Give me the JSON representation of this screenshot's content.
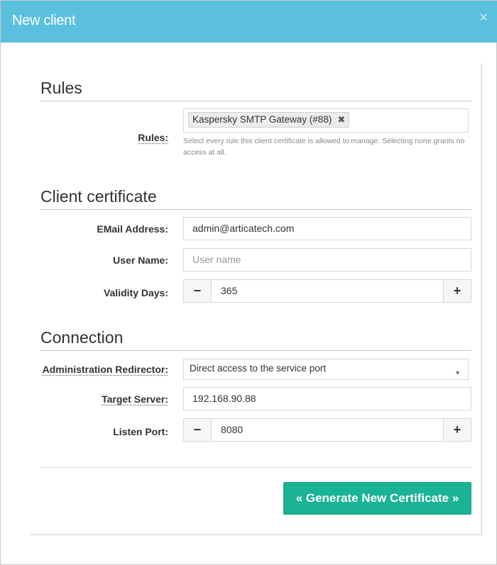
{
  "modal": {
    "title": "New client",
    "close_glyph": "×"
  },
  "sections": {
    "rules": {
      "title": "Rules"
    },
    "certificate": {
      "title": "Client certificate"
    },
    "connection": {
      "title": "Connection"
    }
  },
  "rules_field": {
    "label": "Rules:",
    "selected_tags": [
      "Kaspersky SMTP Gateway (#88)"
    ],
    "remove_glyph": "✖",
    "help": "Select every rule this client certificate is allowed to manage. Selecting none grants no access at all."
  },
  "email": {
    "label": "EMail Address:",
    "value": "admin@articatech.com"
  },
  "username": {
    "label": "User Name:",
    "value": "",
    "placeholder": "User name"
  },
  "validity": {
    "label": "Validity Days:",
    "value": "365",
    "minus": "−",
    "plus": "+"
  },
  "redirector": {
    "label": "Administration Redirector:",
    "selected": "Direct access to the service port",
    "caret": "▼"
  },
  "target": {
    "label": "Target Server:",
    "value": "192.168.90.88"
  },
  "listen_port": {
    "label": "Listen Port:",
    "value": "8080",
    "minus": "−",
    "plus": "+"
  },
  "actions": {
    "generate_label": "« Generate New Certificate »"
  },
  "colors": {
    "header": "#5bc0de",
    "primary_button": "#1ab394"
  },
  "icons": {
    "close": "close-icon",
    "tag_remove": "remove-tag-icon",
    "minus": "minus-icon",
    "plus": "plus-icon",
    "caret": "chevron-down-icon"
  }
}
